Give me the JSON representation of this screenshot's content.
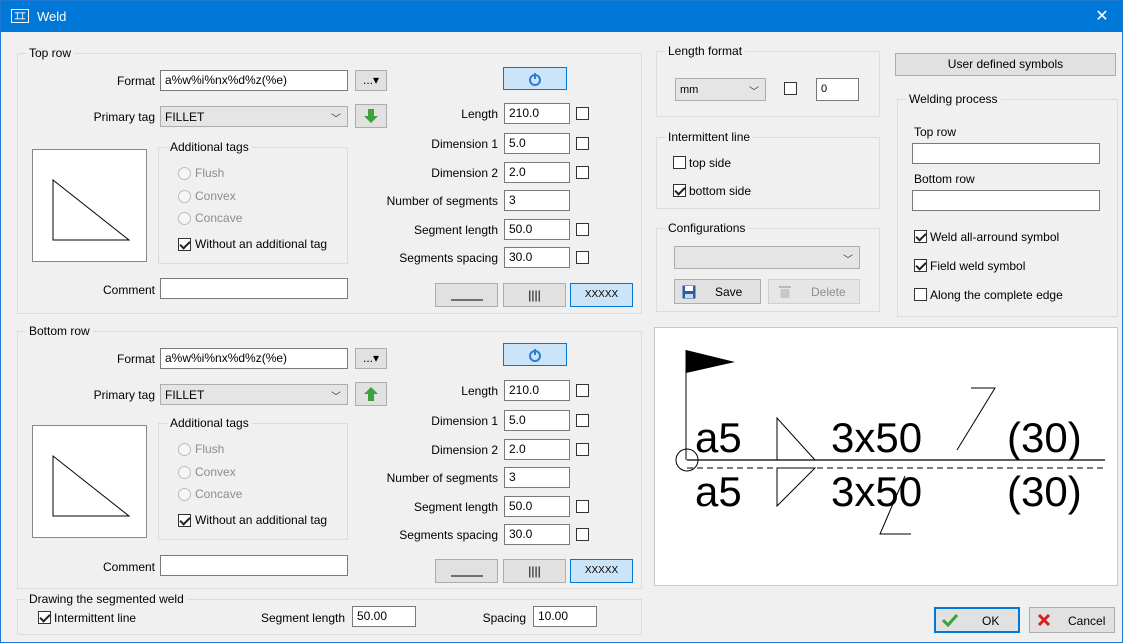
{
  "window": {
    "title": "Weld",
    "app_icon": "weld-app-icon",
    "close_glyph": "✕"
  },
  "top_row": {
    "group_title": "Top row",
    "format_label": "Format",
    "format_value": "a%w%i%nx%d%z(%e)",
    "format_btn": "...▾",
    "primary_tag_label": "Primary tag",
    "primary_tag_value": "FILLET",
    "additional_tags_title": "Additional tags",
    "tags": [
      "Flush",
      "Convex",
      "Concave"
    ],
    "without_tag_label": "Without an additional tag",
    "without_tag_checked": true,
    "comment_label": "Comment",
    "comment_value": "",
    "length_label": "Length",
    "length_value": "210.0",
    "dim1_label": "Dimension 1",
    "dim1_value": "5.0",
    "dim2_label": "Dimension 2",
    "dim2_value": "2.0",
    "segments_label": "Number of segments",
    "segments_value": "3",
    "seg_length_label": "Segment length",
    "seg_length_value": "50.0",
    "seg_spacing_label": "Segments spacing",
    "seg_spacing_value": "30.0",
    "line_btn_3": "XXXXX"
  },
  "bottom_row": {
    "group_title": "Bottom row",
    "format_label": "Format",
    "format_value": "a%w%i%nx%d%z(%e)",
    "format_btn": "...▾",
    "primary_tag_label": "Primary tag",
    "primary_tag_value": "FILLET",
    "additional_tags_title": "Additional tags",
    "tags": [
      "Flush",
      "Convex",
      "Concave"
    ],
    "without_tag_label": "Without an additional tag",
    "without_tag_checked": true,
    "comment_label": "Comment",
    "comment_value": "",
    "length_label": "Length",
    "length_value": "210.0",
    "dim1_label": "Dimension 1",
    "dim1_value": "5.0",
    "dim2_label": "Dimension 2",
    "dim2_value": "2.0",
    "segments_label": "Number of segments",
    "segments_value": "3",
    "seg_length_label": "Segment length",
    "seg_length_value": "50.0",
    "seg_spacing_label": "Segments spacing",
    "seg_spacing_value": "30.0",
    "line_btn_3": "XXXXX"
  },
  "segmented": {
    "group_title": "Drawing the segmented weld",
    "intermittent_label": "Intermittent line",
    "intermittent_checked": true,
    "seg_length_label": "Segment length",
    "seg_length_value": "50.00",
    "spacing_label": "Spacing",
    "spacing_value": "10.00"
  },
  "length_format": {
    "group_title": "Length format",
    "unit_value": "mm",
    "precision_value": "0"
  },
  "intermittent_line": {
    "group_title": "Intermittent line",
    "top_side_label": "top side",
    "top_side_checked": false,
    "bottom_side_label": "bottom side",
    "bottom_side_checked": true
  },
  "configurations": {
    "group_title": "Configurations",
    "selected": "",
    "save_label": "Save",
    "delete_label": "Delete"
  },
  "right_panel": {
    "user_symbols_label": "User defined symbols",
    "welding_process_title": "Welding process",
    "top_row_label": "Top row",
    "top_row_value": "",
    "bottom_row_label": "Bottom row",
    "bottom_row_value": "",
    "all_around_label": "Weld all-arround symbol",
    "all_around_checked": true,
    "field_weld_label": "Field weld symbol",
    "field_weld_checked": true,
    "complete_edge_label": "Along the complete edge",
    "complete_edge_checked": false
  },
  "preview": {
    "top_a": "a5",
    "top_seg": "3x50",
    "top_space": "(30)",
    "bot_a": "a5",
    "bot_seg": "3x50",
    "bot_space": "(30)"
  },
  "footer": {
    "ok_label": "OK",
    "cancel_label": "Cancel"
  },
  "colors": {
    "titlebar": "#0078d7",
    "accent_border": "#0078d7",
    "arrow_green": "#3ca33c",
    "cancel_red": "#d42020"
  }
}
